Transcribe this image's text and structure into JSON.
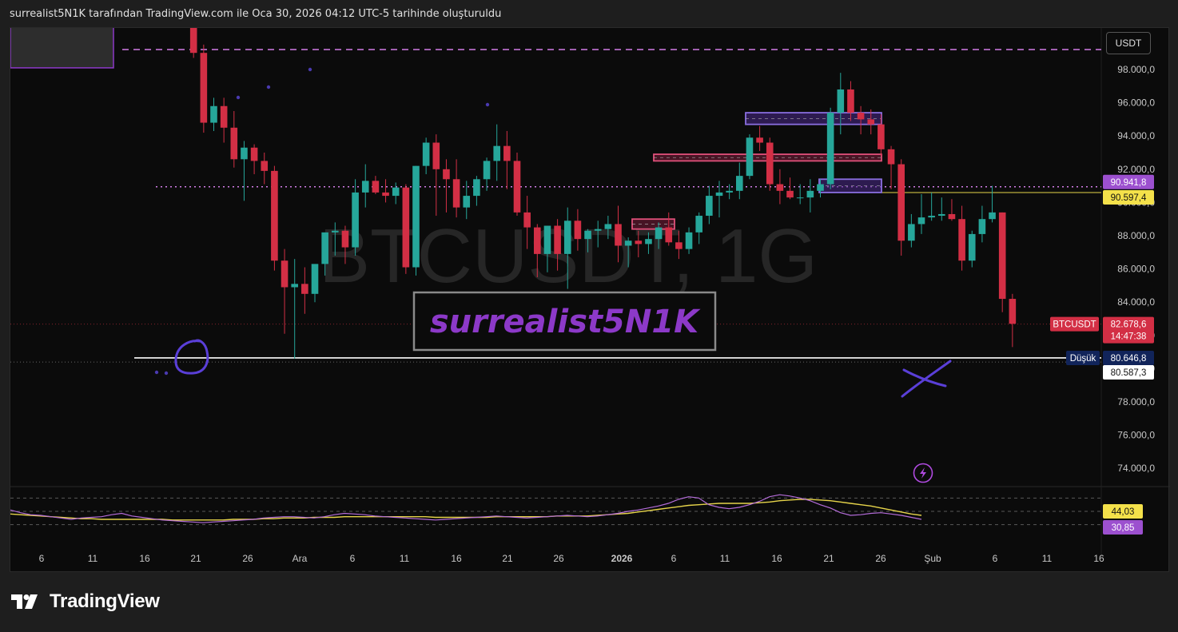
{
  "header": {
    "text": "surrealist5N1K tarafından TradingView.com ile Oca 30, 2026 04:12 UTC-5 tarihinde oluşturuldu"
  },
  "currency_button": "USDT",
  "brand": {
    "name": "TradingView",
    "logo_icon": "tradingview-logo-icon"
  },
  "watermark": {
    "symbol": "BTCUSDT, 1G",
    "author": "surrealist5N1K"
  },
  "colors": {
    "up": "#26a69a",
    "down": "#d32f45",
    "rsi": "#b46cd9",
    "rsi_ma": "#e6d44a",
    "accent_purple": "#8c39c8",
    "level_pink": "#d27de8"
  },
  "price_axis": {
    "ticks": [
      "98.000,0",
      "96.000,0",
      "94.000,0",
      "92.000,0",
      "90.000,0",
      "88.000,0",
      "86.000,0",
      "84.000,0",
      "82.000,0",
      "80.000,0",
      "78.000,0",
      "76.000,0",
      "74.000,0"
    ]
  },
  "time_axis": {
    "labels": [
      "6",
      "11",
      "16",
      "21",
      "26",
      "Ara",
      "6",
      "11",
      "16",
      "21",
      "26",
      "2026",
      "6",
      "11",
      "16",
      "21",
      "26",
      "Şub",
      "6",
      "11",
      "16"
    ]
  },
  "price_tags": {
    "level_1": "90.941,8",
    "level_2": "90.597,4",
    "symbol_label": "BTCUSDT",
    "last_price": "82.678,6",
    "countdown": "14:47:38",
    "low_label": "Düşük",
    "low_value": "80.646,8",
    "crosshair": "80.587,3",
    "rsi_value": "44,03",
    "rsi_ma_value": "30,85"
  },
  "chart_data": {
    "type": "candlestick",
    "interval": "1G",
    "symbol": "BTCUSDT",
    "ylim": [
      72800,
      100500
    ],
    "candles": [
      [
        104500,
        105500,
        103500,
        105000
      ],
      [
        105000,
        106500,
        104500,
        106000
      ],
      [
        106000,
        106500,
        104800,
        105200
      ],
      [
        105200,
        105800,
        104000,
        104500
      ],
      [
        104500,
        105200,
        103200,
        103800
      ],
      [
        103800,
        104500,
        102800,
        103500
      ],
      [
        103500,
        104000,
        101500,
        102200
      ],
      [
        102200,
        102600,
        100600,
        101100
      ],
      [
        101100,
        101800,
        98700,
        99000
      ],
      [
        99000,
        99500,
        94200,
        94800
      ],
      [
        94800,
        96300,
        94300,
        95800
      ],
      [
        95800,
        96300,
        93600,
        94500
      ],
      [
        94500,
        95500,
        92100,
        92600
      ],
      [
        92600,
        93700,
        90100,
        93300
      ],
      [
        93300,
        93500,
        91700,
        92500
      ],
      [
        92500,
        93000,
        91100,
        91900
      ],
      [
        91900,
        92200,
        85900,
        86500
      ],
      [
        86500,
        87200,
        82100,
        84900
      ],
      [
        84900,
        86600,
        80600,
        85100
      ],
      [
        85100,
        86100,
        83300,
        84500
      ],
      [
        84500,
        86000,
        84000,
        86300
      ],
      [
        86300,
        87500,
        85600,
        88200
      ],
      [
        88200,
        88800,
        86800,
        88300
      ],
      [
        88300,
        88600,
        86300,
        87300
      ],
      [
        87300,
        91400,
        86800,
        90600
      ],
      [
        90600,
        92300,
        89700,
        91300
      ],
      [
        91300,
        91600,
        90500,
        90600
      ],
      [
        90600,
        91400,
        90000,
        90400
      ],
      [
        90400,
        91200,
        89900,
        90900
      ],
      [
        90900,
        91100,
        85700,
        86100
      ],
      [
        86100,
        92200,
        85600,
        92200
      ],
      [
        92200,
        93900,
        91700,
        93600
      ],
      [
        93600,
        94100,
        89200,
        92000
      ],
      [
        92000,
        92600,
        89400,
        91400
      ],
      [
        91400,
        92600,
        89100,
        89700
      ],
      [
        89700,
        91300,
        89000,
        90400
      ],
      [
        90400,
        91600,
        89800,
        91400
      ],
      [
        91400,
        92700,
        90700,
        92500
      ],
      [
        92500,
        94700,
        91300,
        93400
      ],
      [
        93400,
        94300,
        90800,
        92500
      ],
      [
        92500,
        93000,
        89200,
        89400
      ],
      [
        89400,
        90400,
        87200,
        88500
      ],
      [
        88500,
        88700,
        85500,
        86900
      ],
      [
        86900,
        88600,
        85800,
        88600
      ],
      [
        88600,
        89000,
        85900,
        86900
      ],
      [
        86900,
        89700,
        84800,
        88900
      ],
      [
        88900,
        89600,
        87100,
        87800
      ],
      [
        87800,
        88400,
        87000,
        88300
      ],
      [
        88300,
        88900,
        87300,
        88400
      ],
      [
        88400,
        89200,
        87800,
        88700
      ],
      [
        88700,
        89800,
        86400,
        87400
      ],
      [
        87400,
        87900,
        86100,
        87700
      ],
      [
        87700,
        88300,
        86700,
        87500
      ],
      [
        87500,
        88200,
        86900,
        87800
      ],
      [
        87800,
        88800,
        87200,
        88500
      ],
      [
        88500,
        89400,
        87400,
        87600
      ],
      [
        87600,
        88300,
        86600,
        87200
      ],
      [
        87200,
        88500,
        86900,
        88200
      ],
      [
        88200,
        89400,
        87500,
        89200
      ],
      [
        89200,
        91000,
        88700,
        90400
      ],
      [
        90400,
        91300,
        89100,
        90600
      ],
      [
        90600,
        91100,
        90200,
        90700
      ],
      [
        90700,
        92400,
        90200,
        91600
      ],
      [
        91600,
        94100,
        91400,
        93900
      ],
      [
        93900,
        94600,
        93100,
        93600
      ],
      [
        93600,
        93900,
        90700,
        91100
      ],
      [
        91100,
        92000,
        89900,
        90700
      ],
      [
        90700,
        91500,
        90200,
        90300
      ],
      [
        90300,
        91100,
        89900,
        90300
      ],
      [
        90300,
        91400,
        89400,
        90700
      ],
      [
        90700,
        91400,
        90300,
        91100
      ],
      [
        91100,
        95700,
        90800,
        95400
      ],
      [
        95400,
        97800,
        94100,
        96800
      ],
      [
        96800,
        97300,
        94900,
        95400
      ],
      [
        95400,
        95800,
        94100,
        95000
      ],
      [
        95000,
        95600,
        94100,
        94700
      ],
      [
        94700,
        95300,
        92800,
        93200
      ],
      [
        93200,
        93400,
        90800,
        92300
      ],
      [
        92300,
        92600,
        86800,
        87700
      ],
      [
        87700,
        89300,
        87300,
        88700
      ],
      [
        88700,
        90500,
        88100,
        89100
      ],
      [
        89100,
        90600,
        88900,
        89200
      ],
      [
        89200,
        90300,
        88900,
        89300
      ],
      [
        89300,
        90200,
        88900,
        89000
      ],
      [
        89000,
        89800,
        85900,
        86500
      ],
      [
        86500,
        88300,
        86100,
        88100
      ],
      [
        88100,
        89800,
        87600,
        89000
      ],
      [
        89000,
        91000,
        88800,
        89400
      ],
      [
        89400,
        89400,
        83400,
        84200
      ],
      [
        84200,
        84500,
        81300,
        82700
      ]
    ],
    "levels": [
      {
        "price": 99200,
        "style": "dashed",
        "color": "#d27de8"
      },
      {
        "price": 90941.8,
        "style": "dotted",
        "color": "#d27de8"
      },
      {
        "price": 90597.4,
        "style": "solid",
        "color": "#e6d44a"
      },
      {
        "price": 80646.8,
        "style": "solid",
        "color": "#ffffff"
      },
      {
        "price": 82678.6,
        "style": "dotted",
        "color": "#d32f45"
      }
    ],
    "zones": [
      {
        "top": 95400,
        "bottom": 94700,
        "kind": "bearish"
      },
      {
        "top": 92900,
        "bottom": 92500,
        "kind": "bullish"
      },
      {
        "top": 91400,
        "bottom": 90600,
        "kind": "bearish"
      },
      {
        "top": 89000,
        "bottom": 88400,
        "kind": "bullish"
      },
      {
        "top": 101000,
        "bottom": 98100,
        "kind": "bearish"
      }
    ],
    "rsi": [
      52,
      48,
      45,
      44,
      42,
      40,
      38,
      40,
      41,
      42,
      45,
      47,
      43,
      41,
      39,
      37,
      36,
      35,
      34,
      33,
      34,
      35,
      36,
      37,
      38,
      40,
      41,
      42,
      42,
      41,
      40,
      42,
      45,
      47,
      46,
      45,
      43,
      42,
      41,
      40,
      39,
      38,
      37,
      38,
      39,
      40,
      41,
      42,
      43,
      42,
      41,
      40,
      41,
      42,
      43,
      44,
      43,
      42,
      43,
      45,
      47,
      50,
      52,
      55,
      58,
      62,
      68,
      72,
      70,
      60,
      56,
      54,
      56,
      60,
      65,
      72,
      75,
      73,
      70,
      66,
      60,
      55,
      48,
      44,
      45,
      47,
      48,
      46,
      44,
      41,
      38
    ],
    "rsi_ma": [
      46,
      45,
      44,
      43,
      42,
      41,
      40,
      39,
      39,
      38,
      38,
      38,
      38,
      38,
      38,
      38,
      37,
      37,
      37,
      37,
      37,
      37,
      38,
      38,
      38,
      39,
      39,
      40,
      40,
      40,
      41,
      41,
      41,
      42,
      42,
      42,
      42,
      42,
      42,
      42,
      42,
      42,
      41,
      41,
      41,
      41,
      41,
      41,
      42,
      42,
      42,
      42,
      42,
      42,
      43,
      43,
      43,
      43,
      44,
      45,
      46,
      47,
      49,
      51,
      53,
      55,
      57,
      59,
      60,
      61,
      62,
      62,
      62,
      62,
      63,
      64,
      66,
      67,
      68,
      68,
      67,
      66,
      64,
      62,
      60,
      58,
      55,
      52,
      49,
      46,
      44
    ],
    "rsi_levels": [
      70,
      50,
      30
    ]
  }
}
